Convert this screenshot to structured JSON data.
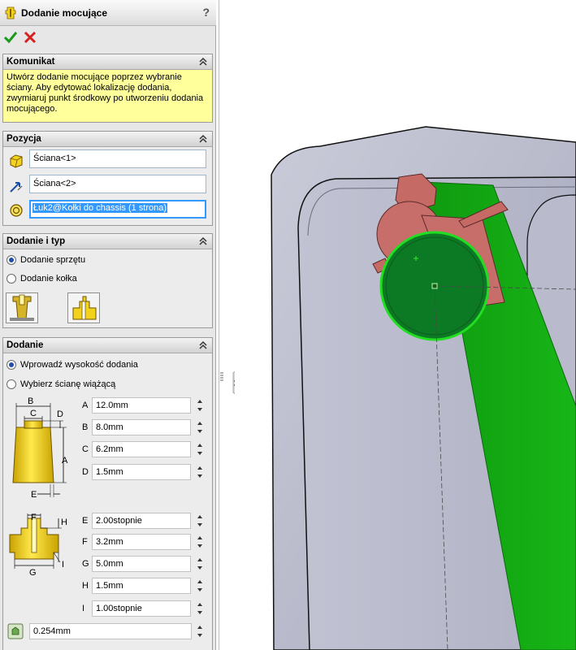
{
  "title": "Dodanie mocujące",
  "help_label": "?",
  "komunikat": {
    "title": "Komunikat",
    "message": "Utwórz dodanie mocujące poprzez wybranie ściany. Aby edytować lokalizację dodania, zwymiaruj punkt środkowy po utworzeniu dodania mocującego."
  },
  "pozycja": {
    "title": "Pozycja",
    "face1": "Ściana<1>",
    "face2": "Ściana<2>",
    "edge": "Łuk2@Kołki do chassis (1 strona)"
  },
  "dodanie_typ": {
    "title": "Dodanie i typ",
    "option1": "Dodanie sprzętu",
    "option2": "Dodanie kołka",
    "selected": "option1"
  },
  "dodanie": {
    "title": "Dodanie",
    "option1": "Wprowadź wysokość dodania",
    "option2": "Wybierz ścianę wiążącą",
    "selected": "option1",
    "diagram1_labels": {
      "b": "B",
      "c": "C",
      "d": "D",
      "a": "A",
      "e": "E"
    },
    "diagram2_labels": {
      "f": "F",
      "h": "H",
      "g": "G",
      "i": "I"
    },
    "dims1": [
      {
        "label": "A",
        "value": "12.0mm"
      },
      {
        "label": "B",
        "value": "8.0mm"
      },
      {
        "label": "C",
        "value": "6.2mm"
      },
      {
        "label": "D",
        "value": "1.5mm"
      }
    ],
    "dims2": [
      {
        "label": "E",
        "value": "2.00stopnie"
      },
      {
        "label": "F",
        "value": "3.2mm"
      },
      {
        "label": "G",
        "value": "5.0mm"
      },
      {
        "label": "H",
        "value": "1.5mm"
      },
      {
        "label": "I",
        "value": "1.00stopnie"
      }
    ],
    "clearance": "0.254mm"
  },
  "colors": {
    "selection_green": "#11a011",
    "boss_red": "#c66a66",
    "model_gray": "#b7b9c9",
    "message_yellow": "#ffff9c",
    "hardware_yellow": "#f2d21a"
  }
}
